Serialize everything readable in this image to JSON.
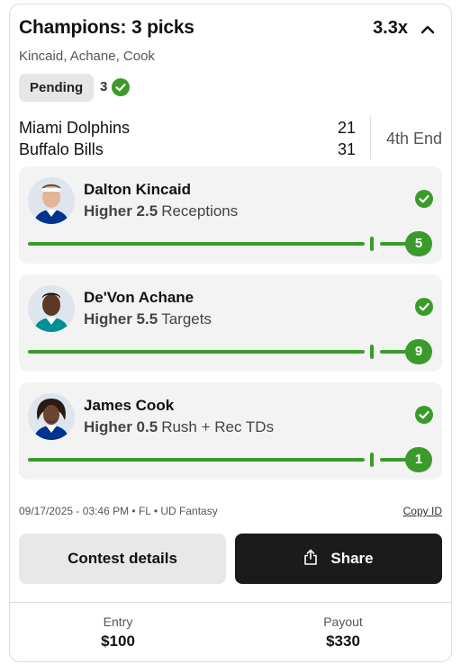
{
  "header": {
    "title": "Champions: 3 picks",
    "multiplier": "3.3x",
    "subtitle": "Kincaid, Achane, Cook"
  },
  "status": {
    "badge": "Pending",
    "win_count": "3"
  },
  "game": {
    "team1": "Miami Dolphins",
    "score1": "21",
    "team2": "Buffalo Bills",
    "score2": "31",
    "period": "4th End"
  },
  "picks": [
    {
      "name": "Dalton Kincaid",
      "direction": "Higher 2.5",
      "stat": "Receptions",
      "value": "5",
      "jersey_color": "#00338d"
    },
    {
      "name": "De'Von Achane",
      "direction": "Higher 5.5",
      "stat": "Targets",
      "value": "9",
      "jersey_color": "#008e97"
    },
    {
      "name": "James Cook",
      "direction": "Higher 0.5",
      "stat": "Rush + Rec TDs",
      "value": "1",
      "jersey_color": "#00338d"
    }
  ],
  "meta": {
    "timestamp": "09/17/2025 - 03:46 PM • FL • UD Fantasy",
    "copy_id": "Copy ID"
  },
  "actions": {
    "contest_details": "Contest details",
    "share": "Share"
  },
  "footer": {
    "entry_label": "Entry",
    "entry_value": "$100",
    "payout_label": "Payout",
    "payout_value": "$330"
  },
  "colors": {
    "accent_green": "#3a9b2a",
    "card_bg": "#f3f3f3",
    "dark_button": "#1b1b1b"
  }
}
